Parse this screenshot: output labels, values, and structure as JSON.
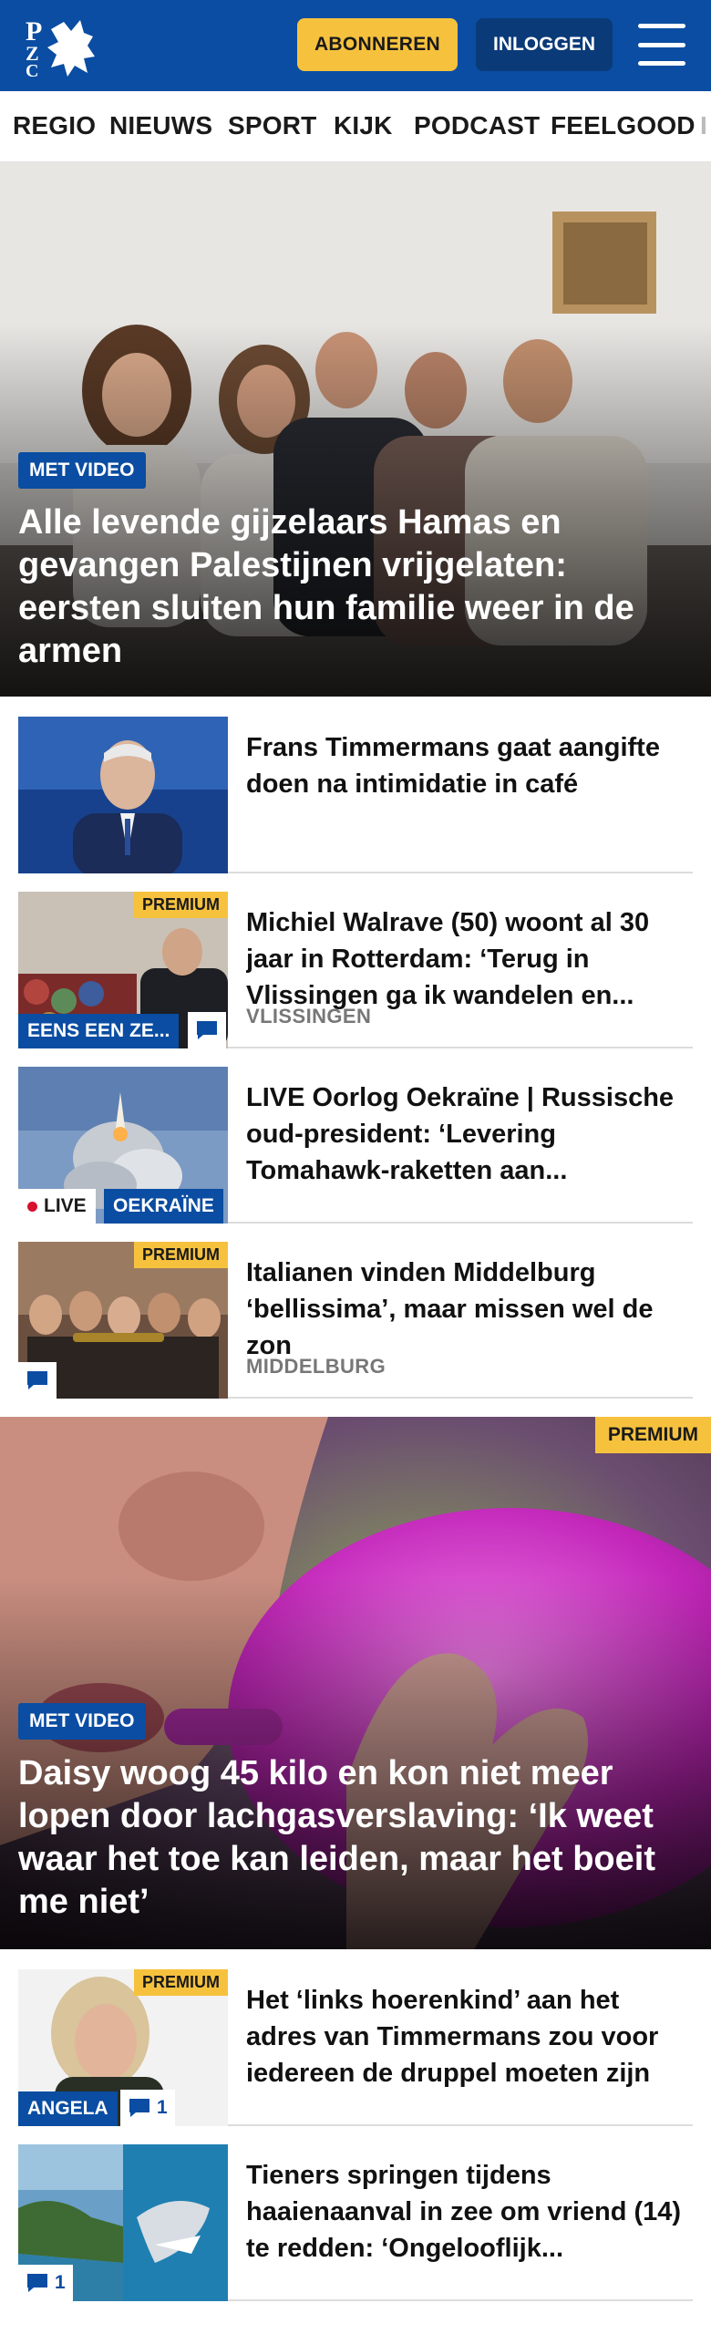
{
  "header": {
    "logo_alt": "PZC",
    "subscribe_label": "ABONNEREN",
    "login_label": "INLOGGEN"
  },
  "nav": {
    "items": [
      "REGIO",
      "NIEUWS",
      "SPORT",
      "KIJK",
      "PODCAST",
      "FEELGOOD"
    ]
  },
  "hero1": {
    "badge": "MET VIDEO",
    "title": "Alle levende gijzelaars Hamas en gevangen Palestijnen vrijgelaten: eersten sluiten hun familie weer in de armen"
  },
  "articles": [
    {
      "title": "Frans Timmermans gaat aangifte doen na intimidatie in café"
    },
    {
      "title": "Michiel Walrave (50) woont al 30 jaar in Rotterdam: ‘Terug in Vlissingen ga ik wandelen en...",
      "location": "VLISSINGEN",
      "premium": "PREMIUM",
      "series_label": "EENS EEN ZE..."
    },
    {
      "title": "LIVE Oorlog Oekraïne | Russische oud-president: ‘Levering Tomahawk-raketten aan...",
      "live_label": "LIVE",
      "topic_label": "OEKRAÏNE"
    },
    {
      "title": "Italianen vinden Middelburg ‘bellissima’, maar missen wel de zon",
      "location": "MIDDELBURG",
      "premium": "PREMIUM"
    }
  ],
  "hero2": {
    "premium": "PREMIUM",
    "badge": "MET VIDEO",
    "title": "Daisy woog 45 kilo en kon niet meer lopen door lachgasverslaving: ‘Ik weet waar het toe kan leiden, maar het boeit me niet’"
  },
  "articles2": [
    {
      "title": "Het ‘links hoerenkind’ aan het adres van Timmermans zou voor iedereen de druppel moeten zijn",
      "premium": "PREMIUM",
      "author_label": "ANGELA",
      "comments": "1"
    },
    {
      "title": "Tieners springen tijdens haaienaanval in zee om vriend (14) te redden: ‘Ongelooflijk...",
      "comments": "1"
    }
  ],
  "colors": {
    "brand_blue": "#0a4da2",
    "premium_yellow": "#f6c23e",
    "live_red": "#d6102d"
  }
}
